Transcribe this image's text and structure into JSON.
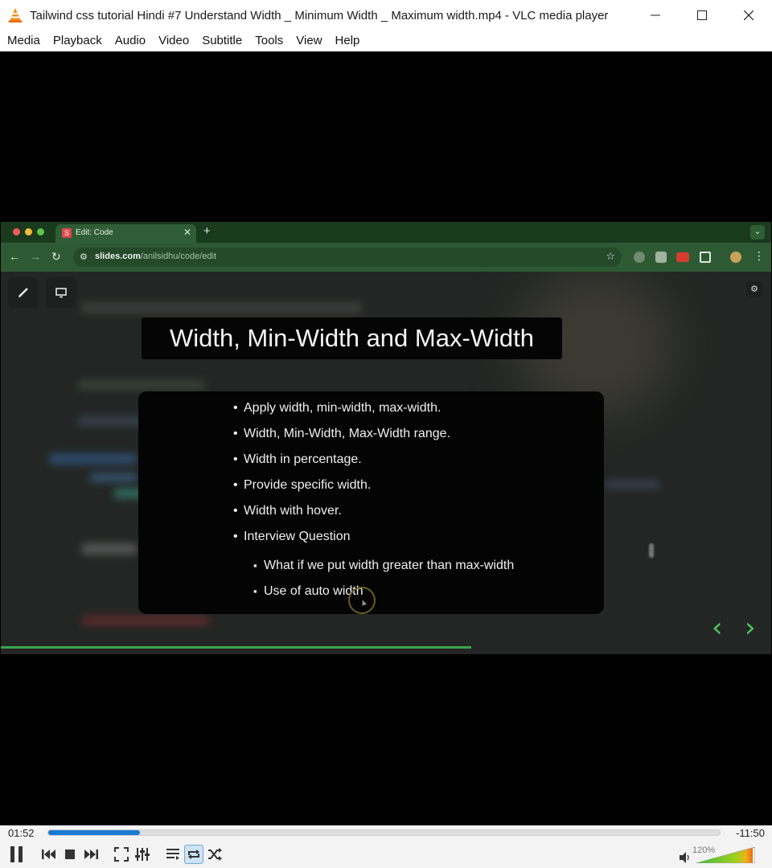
{
  "window": {
    "title": "Tailwind css tutorial Hindi #7 Understand Width _ Minimum Width _ Maximum width.mp4 - VLC media player",
    "icon": "vlc-cone-icon"
  },
  "menu": [
    "Media",
    "Playback",
    "Audio",
    "Video",
    "Subtitle",
    "Tools",
    "View",
    "Help"
  ],
  "browser": {
    "tab_favicon": "S",
    "tab_title": "Edit: Code",
    "url_domain": "slides.com",
    "url_path": "/anilsidhu/code/edit"
  },
  "slide": {
    "title": "Width, Min-Width and Max-Width",
    "bullets": [
      "Apply width, min-width, max-width.",
      "Width, Min-Width, Max-Width range.",
      "Width in percentage.",
      "Provide specific width.",
      "Width with hover.",
      "Interview Question"
    ],
    "sub_bullets": [
      "What if we put width greater than max-width",
      "Use of auto width"
    ]
  },
  "player": {
    "elapsed": "01:52",
    "remaining": "-11:50",
    "progress": 0.136,
    "volume_label": "120%",
    "volume": 1.2,
    "loop_active": true,
    "accent": "#1a79d3"
  }
}
